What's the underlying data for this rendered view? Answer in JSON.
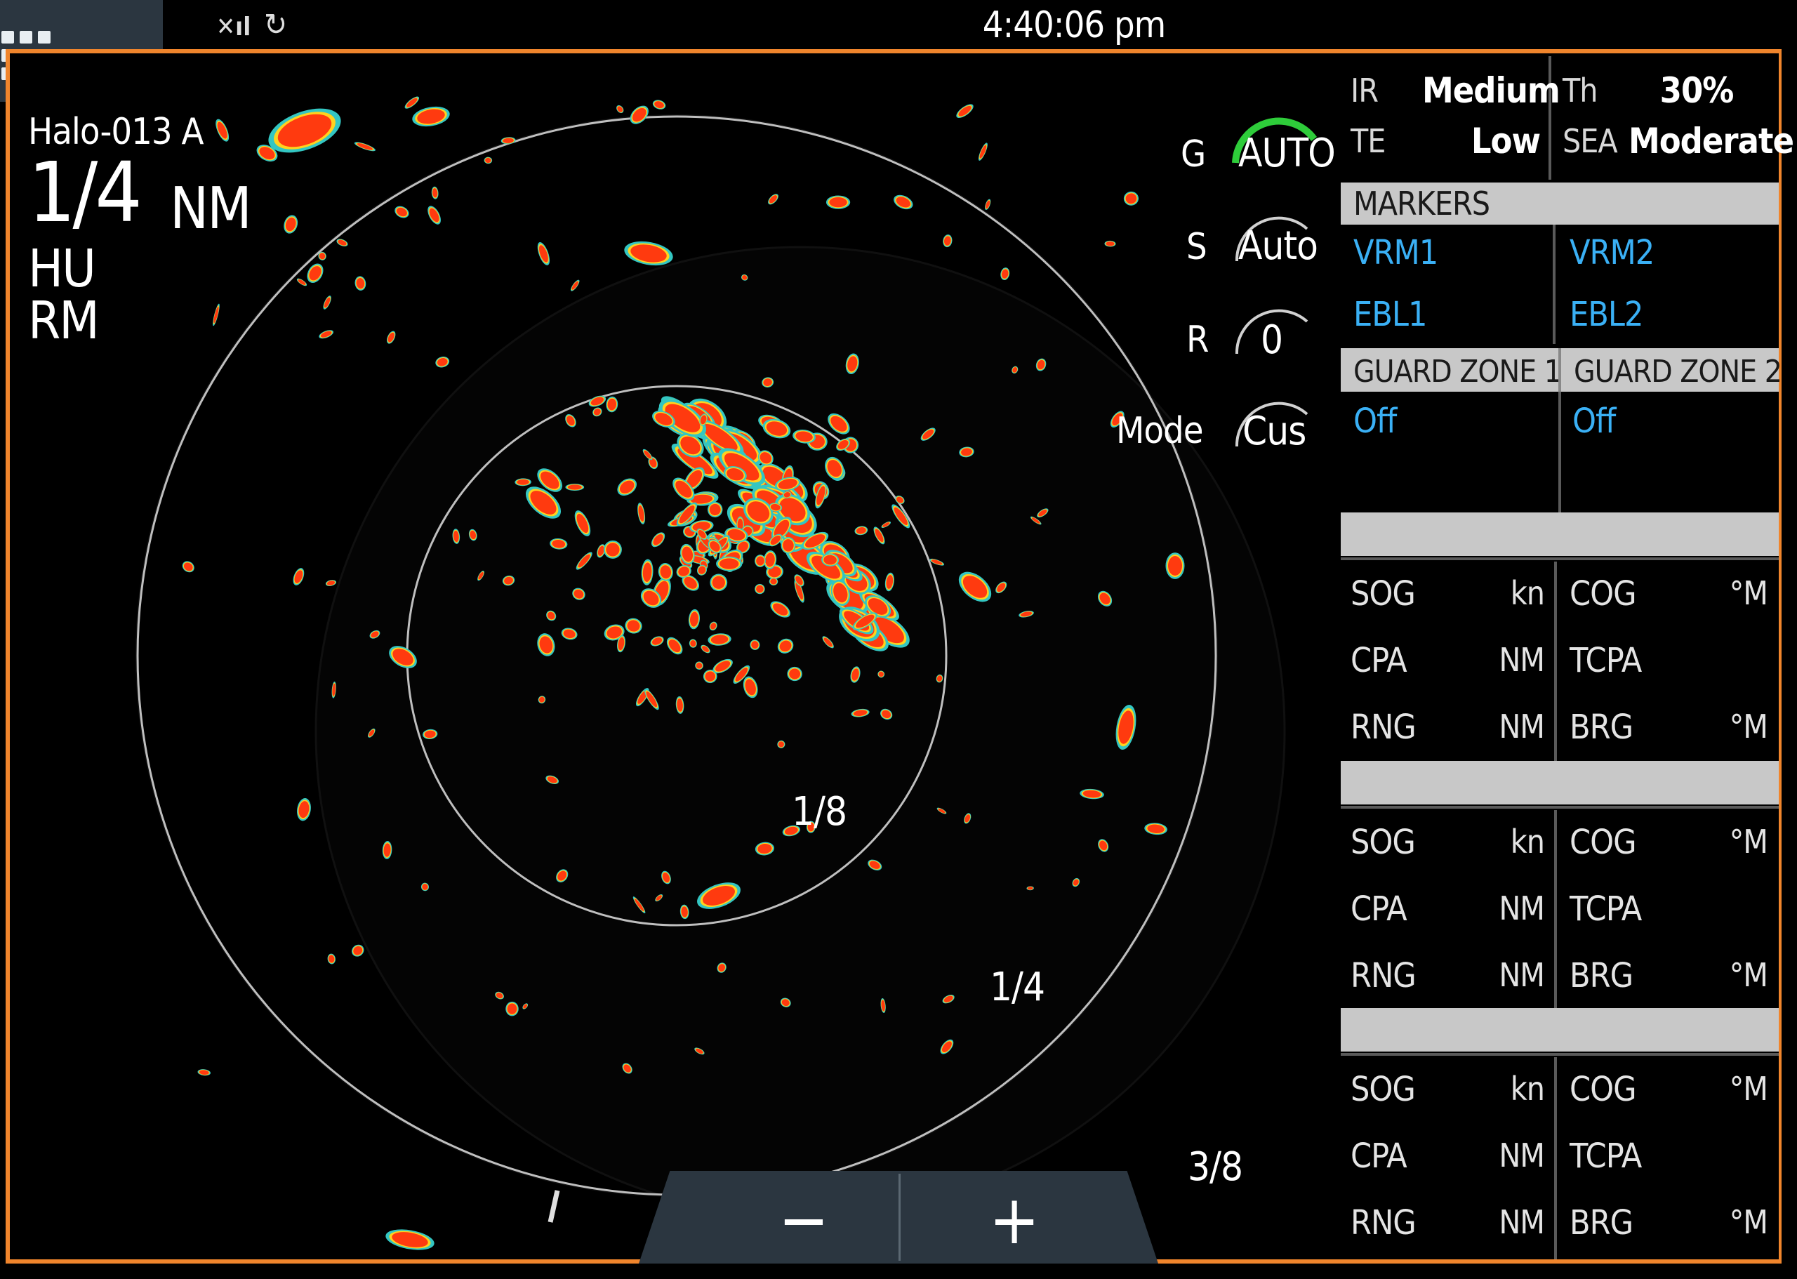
{
  "status": {
    "time": "4:40:06 pm",
    "signal_icon": "signal-icon",
    "sync_icon": "sync-icon"
  },
  "radar": {
    "name": "Halo-013 A",
    "range_value": "1/4",
    "range_unit": "NM",
    "orientation": "HU",
    "motion": "RM",
    "controls": {
      "gain": {
        "label": "G",
        "value": "AUTO"
      },
      "sea": {
        "label": "S",
        "value": "Auto"
      },
      "rain": {
        "label": "R",
        "value": "0"
      },
      "mode": {
        "label": "Mode",
        "value": "Cus"
      }
    },
    "rings": [
      "1/8",
      "1/4",
      "3/8"
    ],
    "zoom": {
      "minus": "−",
      "plus": "+"
    },
    "colors": {
      "frame": "#f0852c",
      "echo_strong": "#ff3a0f",
      "echo_mid": "#ffd21e",
      "echo_weak": "#33c6c2"
    }
  },
  "panel": {
    "settings": [
      {
        "label": "IR",
        "value": "Medium"
      },
      {
        "label": "Th",
        "value": "30%"
      },
      {
        "label": "TE",
        "value": "Low"
      },
      {
        "label": "SEA",
        "value": "Moderate"
      }
    ],
    "markers_header": "MARKERS",
    "markers": [
      "VRM1",
      "VRM2",
      "EBL1",
      "EBL2"
    ],
    "guard_zones": [
      {
        "label": "GUARD ZONE 1",
        "value": "Off"
      },
      {
        "label": "GUARD ZONE 2",
        "value": "Off"
      }
    ],
    "targets": [
      {
        "rows": [
          [
            "SOG",
            "kn",
            "COG",
            "°M"
          ],
          [
            "CPA",
            "NM",
            "TCPA",
            ""
          ],
          [
            "RNG",
            "NM",
            "BRG",
            "°M"
          ]
        ]
      },
      {
        "rows": [
          [
            "SOG",
            "kn",
            "COG",
            "°M"
          ],
          [
            "CPA",
            "NM",
            "TCPA",
            ""
          ],
          [
            "RNG",
            "NM",
            "BRG",
            "°M"
          ]
        ]
      },
      {
        "rows": [
          [
            "SOG",
            "kn",
            "COG",
            "°M"
          ],
          [
            "CPA",
            "NM",
            "TCPA",
            ""
          ],
          [
            "RNG",
            "NM",
            "BRG",
            "°M"
          ]
        ]
      }
    ]
  }
}
